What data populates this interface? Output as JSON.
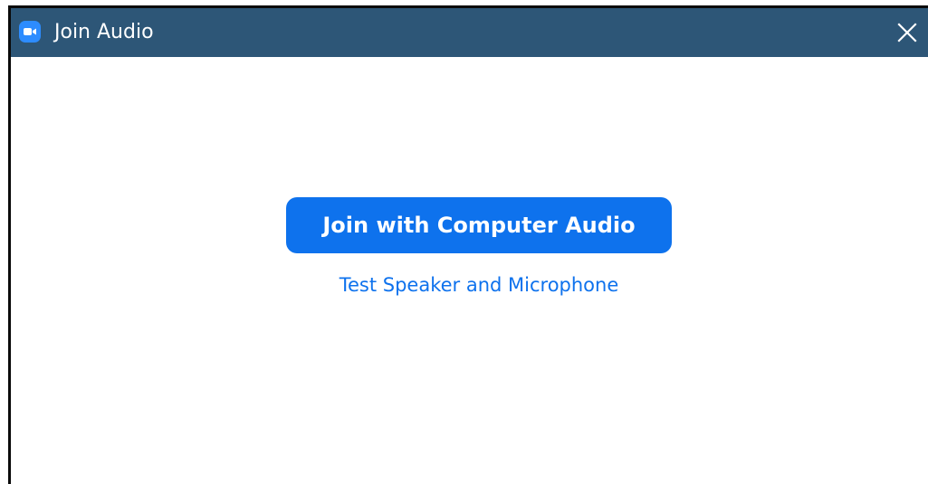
{
  "window": {
    "title": "Join Audio",
    "icon": "zoom-camera-icon",
    "close_icon": "close-icon"
  },
  "main": {
    "join_button_label": "Join with Computer Audio",
    "test_link_label": "Test Speaker and Microphone"
  },
  "colors": {
    "titlebar": "#2d5677",
    "app_icon": "#2d8cff",
    "primary_button": "#0e72ed",
    "link": "#0e72ed",
    "background": "#ffffff"
  }
}
